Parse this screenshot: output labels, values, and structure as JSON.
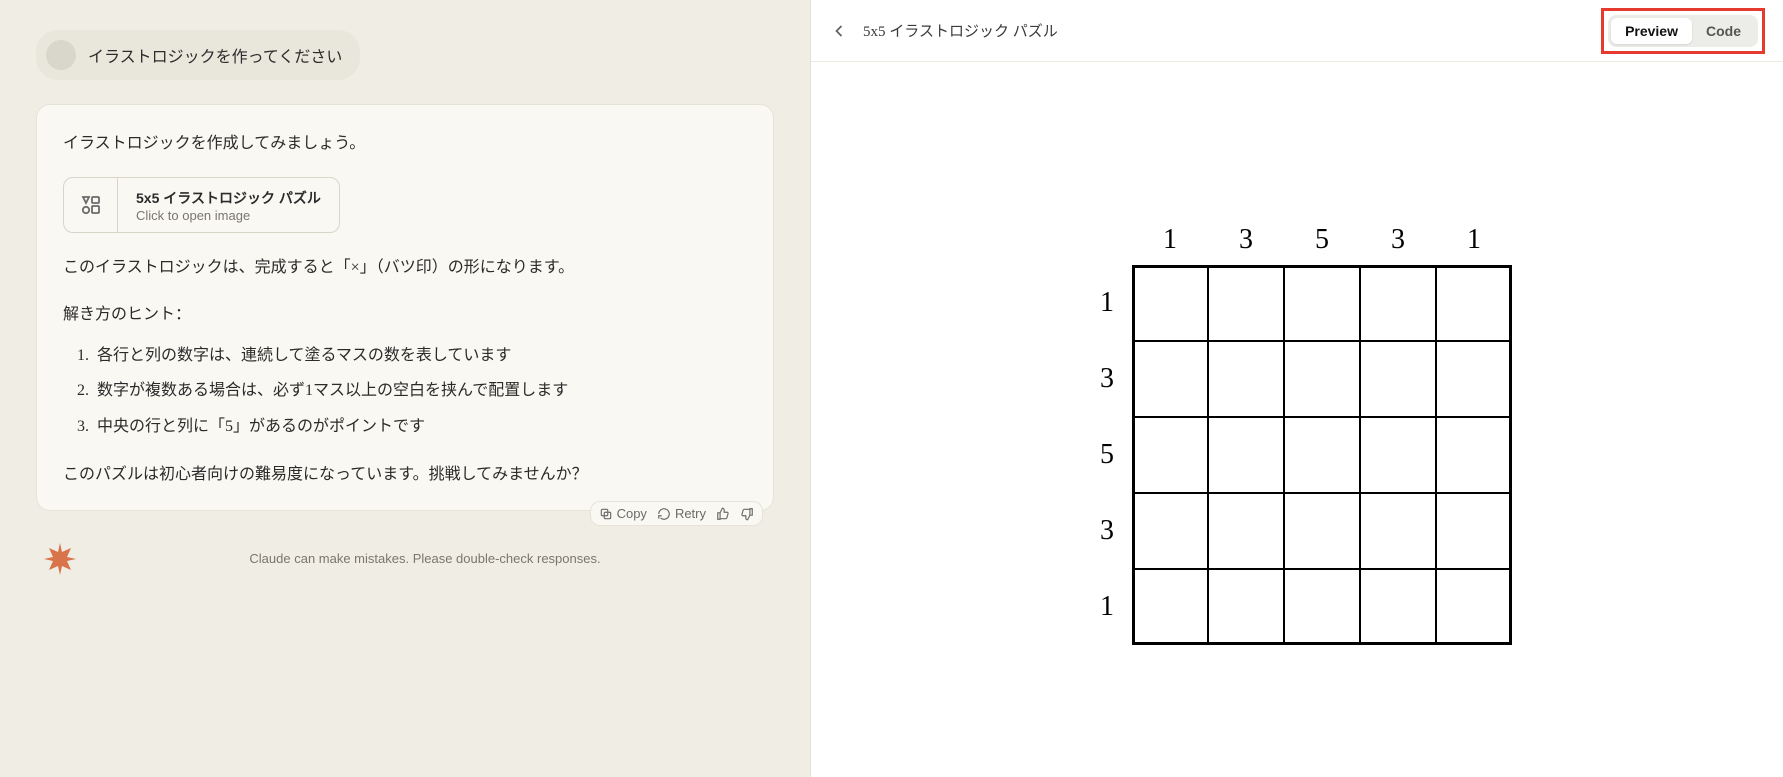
{
  "user_message": "イラストロジックを作ってください",
  "response": {
    "intro": "イラストロジックを作成してみましょう。",
    "artifact": {
      "title": "5x5 イラストロジック パズル",
      "subtitle": "Click to open image"
    },
    "para1": "このイラストロジックは、完成すると「×」（バツ印）の形になります。",
    "hints_heading": "解き方のヒント：",
    "hints": [
      "各行と列の数字は、連続して塗るマスの数を表しています",
      "数字が複数ある場合は、必ず1マス以上の空白を挟んで配置します",
      "中央の行と列に「5」があるのがポイントです"
    ],
    "outro": "このパズルは初心者向けの難易度になっています。挑戦してみませんか？"
  },
  "actions": {
    "copy": "Copy",
    "retry": "Retry"
  },
  "disclaimer": "Claude can make mistakes. Please double-check responses.",
  "right": {
    "title": "5x5 イラストロジック パズル",
    "toggle": {
      "preview": "Preview",
      "code": "Code"
    }
  },
  "chart_data": {
    "type": "table",
    "description": "Nonogram clue grid",
    "col_clues": [
      1,
      3,
      5,
      3,
      1
    ],
    "row_clues": [
      1,
      3,
      5,
      3,
      1
    ]
  }
}
